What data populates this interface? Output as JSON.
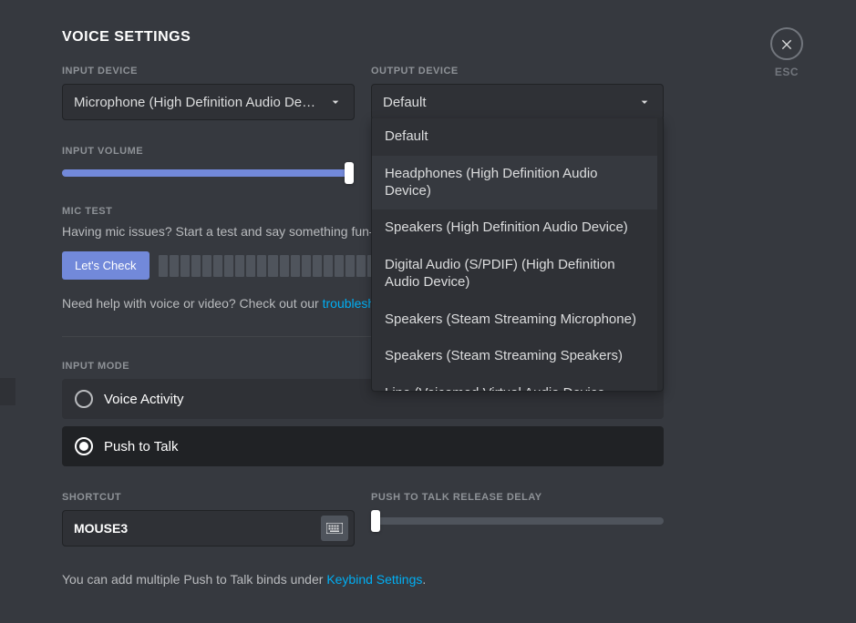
{
  "title": "VOICE SETTINGS",
  "close": {
    "esc": "ESC"
  },
  "input_device": {
    "label": "INPUT DEVICE",
    "value": "Microphone (High Definition Audio Device)"
  },
  "output_device": {
    "label": "OUTPUT DEVICE",
    "value": "Default",
    "options": [
      "Default",
      "Headphones (High Definition Audio Device)",
      "Speakers (High Definition Audio Device)",
      "Digital Audio (S/PDIF) (High Definition Audio Device)",
      "Speakers (Steam Streaming Microphone)",
      "Speakers (Steam Streaming Speakers)",
      "Line (Voicemod Virtual Audio Device (WDM))"
    ],
    "hover_index": 1
  },
  "input_volume": {
    "label": "INPUT VOLUME"
  },
  "mic_test": {
    "label": "MIC TEST",
    "desc": "Having mic issues? Start a test and say something fun—we'll play your voice back to you.",
    "button": "Let's Check"
  },
  "help": {
    "prefix": "Need help with voice or video? Check out our ",
    "link": "troubleshooting guide"
  },
  "input_mode": {
    "label": "INPUT MODE",
    "voice_activity": "Voice Activity",
    "push_to_talk": "Push to Talk"
  },
  "shortcut": {
    "label": "SHORTCUT",
    "value": "MOUSE3"
  },
  "ptt_delay": {
    "label": "PUSH TO TALK RELEASE DELAY"
  },
  "hint": {
    "prefix": "You can add multiple Push to Talk binds under ",
    "link": "Keybind Settings",
    "suffix": "."
  }
}
